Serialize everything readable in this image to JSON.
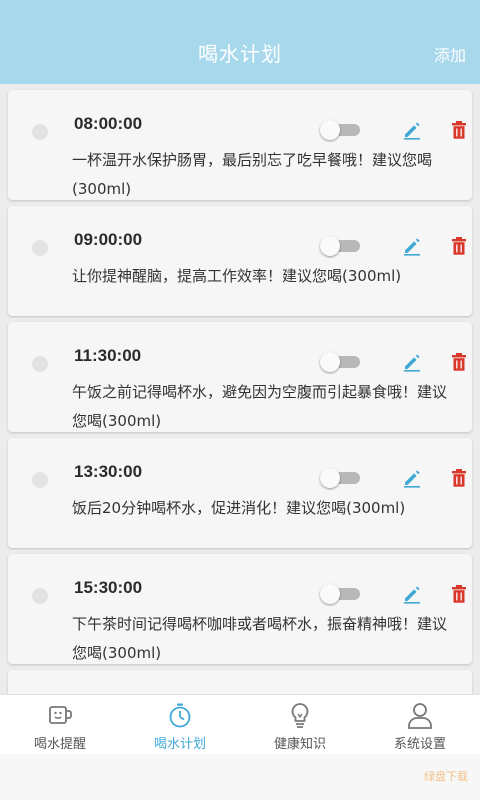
{
  "header": {
    "title": "喝水计划",
    "add_label": "添加"
  },
  "reminders": [
    {
      "time": "08:00:00",
      "text": "一杯温开水保护肠胃，最后别忘了吃早餐哦！建议您喝(300ml)"
    },
    {
      "time": "09:00:00",
      "text": "让你提神醒脑，提高工作效率！建议您喝(300ml)"
    },
    {
      "time": "11:30:00",
      "text": "午饭之前记得喝杯水，避免因为空腹而引起暴食哦！建议您喝(300ml)"
    },
    {
      "time": "13:30:00",
      "text": "饭后20分钟喝杯水，促进消化！建议您喝(300ml)"
    },
    {
      "time": "15:30:00",
      "text": "下午茶时间记得喝杯咖啡或者喝杯水，振奋精神哦！建议您喝(300ml)"
    }
  ],
  "tabs": [
    {
      "label": "喝水提醒",
      "icon": "cup-icon",
      "active": false
    },
    {
      "label": "喝水计划",
      "icon": "timer-icon",
      "active": true
    },
    {
      "label": "健康知识",
      "icon": "lightbulb-icon",
      "active": false
    },
    {
      "label": "系统设置",
      "icon": "user-icon",
      "active": false
    }
  ],
  "colors": {
    "header": "#a8d8ec",
    "active_tab": "#3fa8d6",
    "edit": "#3fa8d6",
    "delete": "#d9372b",
    "toggle_off": "#b8b8b8"
  },
  "watermark": "绿盘下载"
}
